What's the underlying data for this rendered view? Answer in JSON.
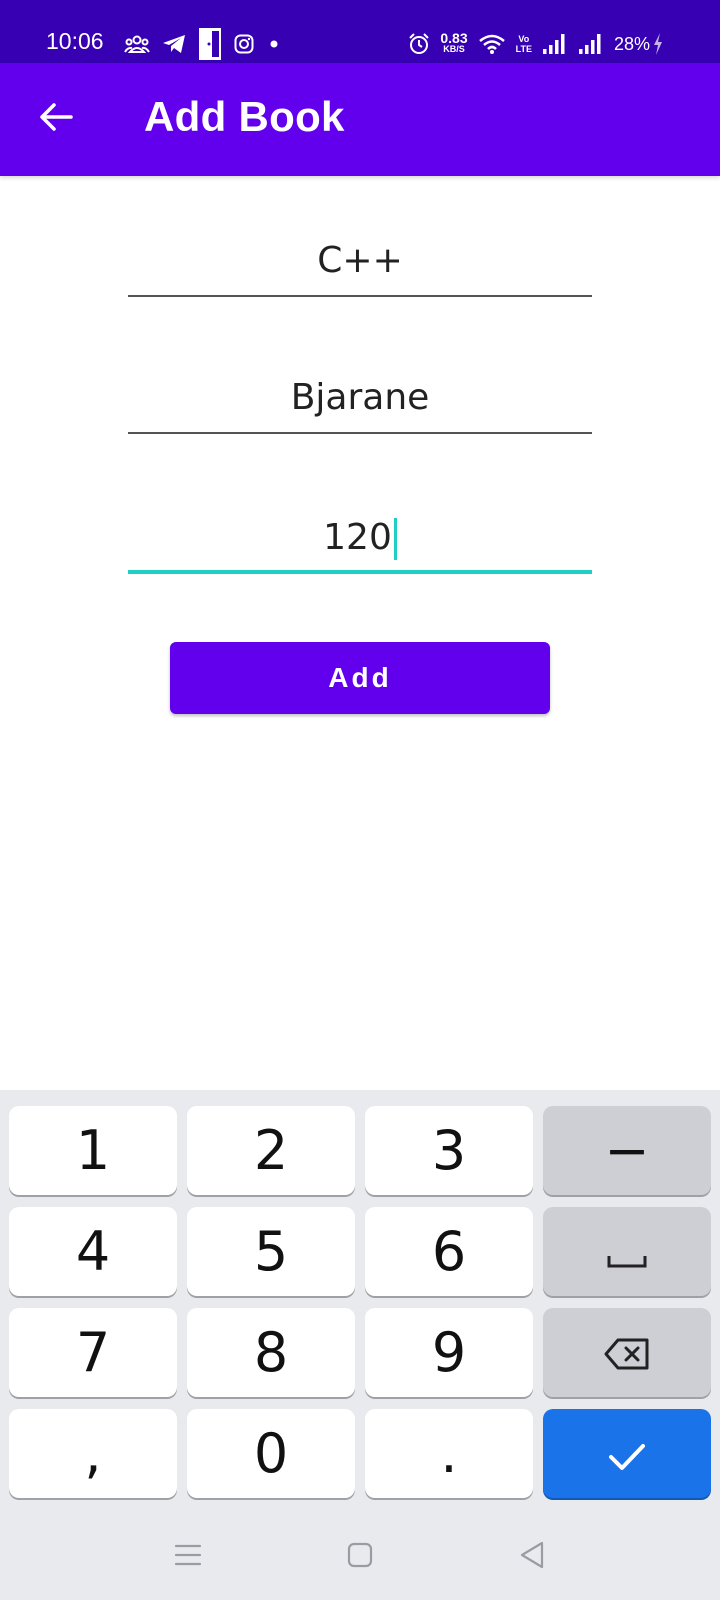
{
  "status_bar": {
    "time": "10:06",
    "net_speed_value": "0.83",
    "net_speed_unit": "KB/S",
    "volte_top": "Vo",
    "volte_bottom": "LTE",
    "battery": "28%",
    "left_icons": [
      "group-icon",
      "telegram-icon",
      "door-icon",
      "instagram-icon",
      "dot-icon"
    ],
    "right_icons": [
      "alarm-icon",
      "wifi-icon",
      "signal-icon",
      "signal-icon",
      "charging-icon"
    ]
  },
  "app_bar": {
    "title": "Add Book",
    "back_icon": "arrow-back-icon"
  },
  "form": {
    "book_name": "C++",
    "author": "Bjarane",
    "pages": "120",
    "add_label": "Add"
  },
  "keyboard": {
    "rows": [
      [
        "1",
        "2",
        "3",
        "−"
      ],
      [
        "4",
        "5",
        "6",
        "space-icon"
      ],
      [
        "7",
        "8",
        "9",
        "backspace-icon"
      ],
      [
        ",",
        "0",
        ".",
        "check-icon"
      ]
    ],
    "key_labels": {
      "k1": "1",
      "k2": "2",
      "k3": "3",
      "minus": "−",
      "k4": "4",
      "k5": "5",
      "k6": "6",
      "k7": "7",
      "k8": "8",
      "k9": "9",
      "comma": ",",
      "k0": "0",
      "period": "."
    },
    "enter_color": "#1a73e8"
  },
  "nav_bar": {
    "buttons": [
      "menu-icon",
      "home-icon",
      "back-triangle-icon"
    ]
  },
  "colors": {
    "status_bar": "#3700b3",
    "primary": "#6200ee",
    "focus_accent": "#1fcfc2"
  }
}
